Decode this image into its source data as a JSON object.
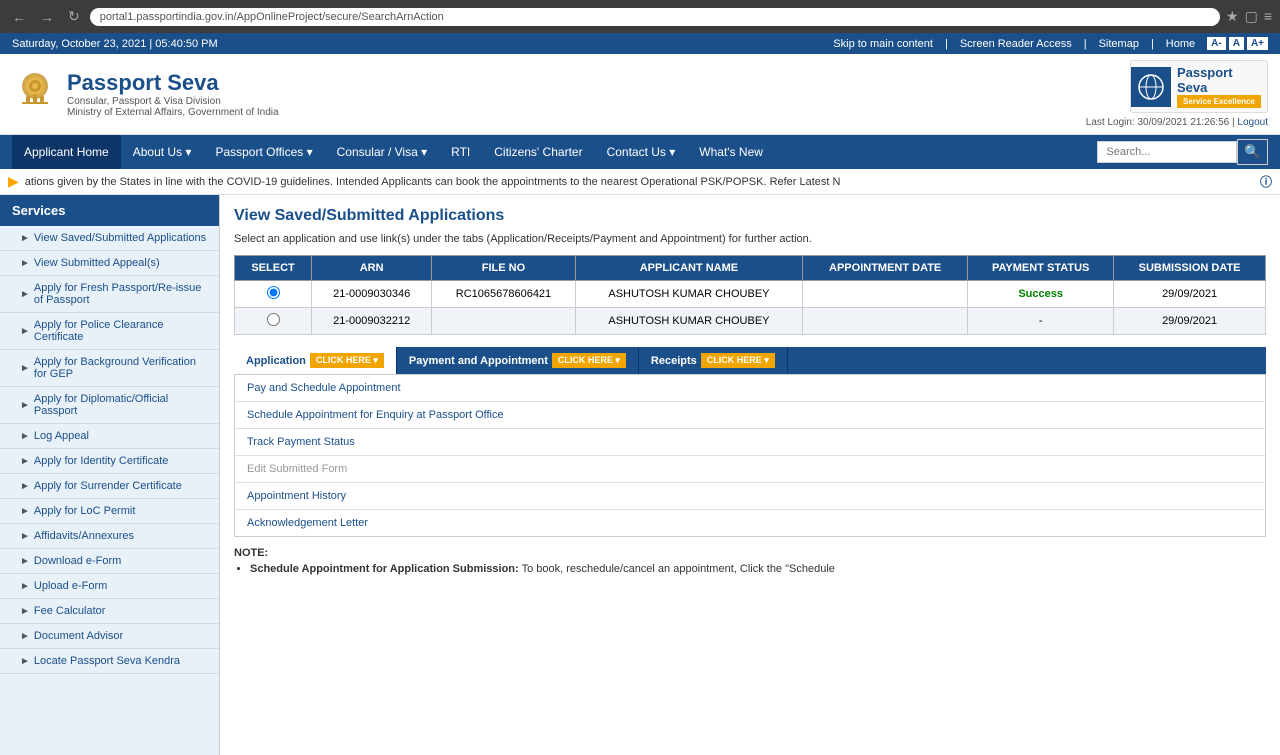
{
  "browser": {
    "url": "portal1.passportindia.gov.in/AppOnlineProject/secure/SearchArnAction"
  },
  "infobar": {
    "datetime": "Saturday,  October  23, 2021 | 05:40:50 PM",
    "skip_link": "Skip to main content",
    "screen_reader": "Screen Reader Access",
    "sitemap": "Sitemap",
    "home": "Home",
    "font_a_minus": "A-",
    "font_a": "A",
    "font_a_plus": "A+"
  },
  "header": {
    "title": "Passport Seva",
    "subtitle1": "Consular, Passport & Visa Division",
    "subtitle2": "Ministry of External Affairs, Government of India",
    "logo_text1": "Passport",
    "logo_text2": "Seva",
    "service_text": "Service Excellence",
    "last_login_label": "Last Login: 30/09/2021",
    "last_login_time": "21:26:56",
    "logout": "Logout"
  },
  "navbar": {
    "items": [
      {
        "label": "Applicant Home",
        "active": true
      },
      {
        "label": "About Us ▾"
      },
      {
        "label": "Passport Offices ▾"
      },
      {
        "label": "Consular / Visa ▾"
      },
      {
        "label": "RTI"
      },
      {
        "label": "Citizens' Charter"
      },
      {
        "label": "Contact Us ▾"
      },
      {
        "label": "What's New"
      }
    ],
    "search_placeholder": "Search..."
  },
  "ticker": {
    "text": "ations given by the States in line with the COVID-19 guidelines. Intended Applicants can book the appointments to the nearest Operational PSK/POPSK. Refer Latest N"
  },
  "sidebar": {
    "header": "Services",
    "items": [
      {
        "label": "View Saved/Submitted Applications"
      },
      {
        "label": "View Submitted Appeal(s)"
      },
      {
        "label": "Apply for Fresh Passport/Re-issue of Passport"
      },
      {
        "label": "Apply for Police Clearance Certificate"
      },
      {
        "label": "Apply for Background Verification for GEP"
      },
      {
        "label": "Apply for Diplomatic/Official Passport"
      },
      {
        "label": "Log Appeal"
      },
      {
        "label": "Apply for Identity Certificate"
      },
      {
        "label": "Apply for Surrender Certificate"
      },
      {
        "label": "Apply for LoC Permit"
      },
      {
        "label": "Affidavits/Annexures"
      },
      {
        "label": "Download e-Form"
      },
      {
        "label": "Upload e-Form"
      },
      {
        "label": "Fee Calculator"
      },
      {
        "label": "Document Advisor"
      },
      {
        "label": "Locate Passport Seva Kendra"
      }
    ]
  },
  "content": {
    "page_title": "View Saved/Submitted Applications",
    "page_desc": "Select an application and use link(s) under the tabs (Application/Receipts/Payment and Appointment) for further action.",
    "table": {
      "columns": [
        "SELECT",
        "ARN",
        "FILE NO",
        "APPLICANT NAME",
        "APPOINTMENT DATE",
        "PAYMENT STATUS",
        "SUBMISSION DATE"
      ],
      "rows": [
        {
          "selected": true,
          "arn": "21-0009030346",
          "file_no": "RC1065678606421",
          "applicant_name": "ASHUTOSH KUMAR CHOUBEY",
          "appointment_date": "",
          "payment_status": "Success",
          "submission_date": "29/09/2021"
        },
        {
          "selected": false,
          "arn": "21-0009032212",
          "file_no": "",
          "applicant_name": "ASHUTOSH KUMAR CHOUBEY",
          "appointment_date": "",
          "payment_status": "-",
          "submission_date": "29/09/2021"
        }
      ]
    },
    "tabs": [
      {
        "label": "Application",
        "btn": "CLICK HERE ▾",
        "active": true
      },
      {
        "label": "Payment and Appointment",
        "btn": "CLICK HERE ▾"
      },
      {
        "label": "Receipts",
        "btn": "CLICK HERE ▾"
      }
    ],
    "action_links": [
      {
        "label": "Pay and Schedule Appointment",
        "enabled": true
      },
      {
        "label": "Schedule Appointment for Enquiry at Passport Office",
        "enabled": true
      },
      {
        "label": "Track Payment Status",
        "enabled": true
      },
      {
        "label": "Edit Submitted Form",
        "enabled": false
      },
      {
        "label": "Appointment History",
        "enabled": true
      },
      {
        "label": "Acknowledgement Letter",
        "enabled": true
      }
    ],
    "note_label": "NOTE:",
    "note_items": [
      {
        "label": "Schedule Appointment for Application Submission:",
        "text": "To book, reschedule/cancel an appointment, Click the \"Schedule"
      }
    ]
  }
}
